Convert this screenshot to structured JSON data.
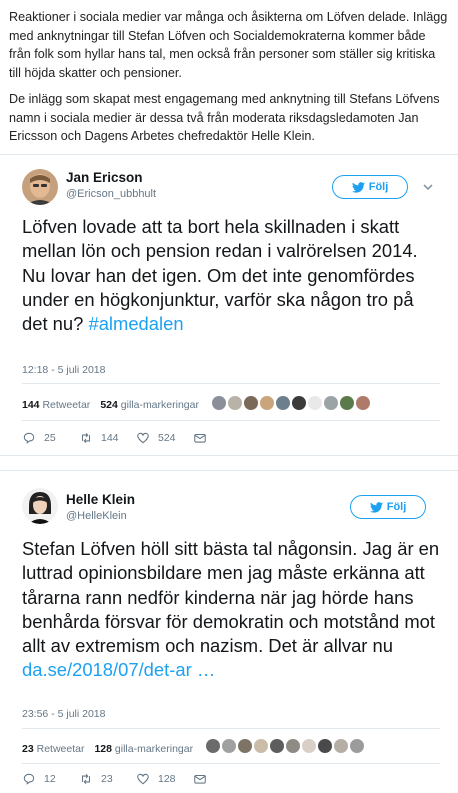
{
  "article": {
    "paragraphs": [
      "Reaktioner i sociala medier var många och åsikterna om Löfven delade. Inlägg med anknytningar till Stefan Löfven och Socialdemokraterna kommer både från folk som hyllar hans tal, men också från personer som ställer sig kritiska till höjda skatter och pensioner.",
      "De inlägg som skapat mest engagemang med anknytning till Stefans Löfvens namn i sociala medier är dessa två från moderata riksdagsledamoten Jan Ericsson och Dagens Arbetes chefredaktör Helle Klein."
    ]
  },
  "tweets": [
    {
      "name": "Jan Ericson",
      "handle": "@Ericson_ubbhult",
      "follow_label": "Följ",
      "text": "Löfven lovade att ta bort hela skillnaden i skatt mellan lön och pension redan i valrörelsen 2014. Nu lovar han det igen. Om det inte genomfördes under en högkonjunktur, varför ska någon tro på det nu? ",
      "hashtag": "#almedalen",
      "time": "12:18 - 5 juli 2018",
      "retweets_count": "144",
      "retweets_label": "Retweetar",
      "likes_count": "524",
      "likes_label": "gilla-markeringar",
      "replies": "25",
      "retweets_action": "144",
      "likes_action": "524",
      "face_colors": [
        "#8a8f99",
        "#b9b2a8",
        "#7a6a58",
        "#caa47a",
        "#6d7f8d",
        "#3b3b3b",
        "#e9e9e9",
        "#9aa3a6",
        "#5b7a4b",
        "#b07a6a"
      ]
    },
    {
      "name": "Helle Klein",
      "handle": "@HelleKlein",
      "follow_label": "Följ",
      "text": "Stefan Löfven höll sitt bästa tal någonsin. Jag är en luttrad  opinionsbildare men jag måste erkänna att tårarna rann nedför kinderna när jag hörde hans benhårda försvar för demokratin och motstånd mot allt av extremism och nazism. Det är allvar nu ",
      "link": "da.se/2018/07/det-ar …",
      "time": "23:56 - 5 juli 2018",
      "retweets_count": "23",
      "retweets_label": "Retweetar",
      "likes_count": "128",
      "likes_label": "gilla-markeringar",
      "replies": "12",
      "retweets_action": "23",
      "likes_action": "128",
      "face_colors": [
        "#6b6b6b",
        "#a0a0a0",
        "#7d7466",
        "#c9bca8",
        "#5d5d5d",
        "#8e8a84",
        "#d8d0c6",
        "#4a4a4a",
        "#b5aea5",
        "#9c9c9c"
      ]
    }
  ],
  "colors": {
    "accent": "#1da1f2",
    "muted": "#657786",
    "border": "#e1e8ed"
  },
  "icons": [
    "twitter-bird-icon",
    "chevron-down-icon",
    "reply-icon",
    "retweet-icon",
    "heart-icon",
    "envelope-icon"
  ]
}
